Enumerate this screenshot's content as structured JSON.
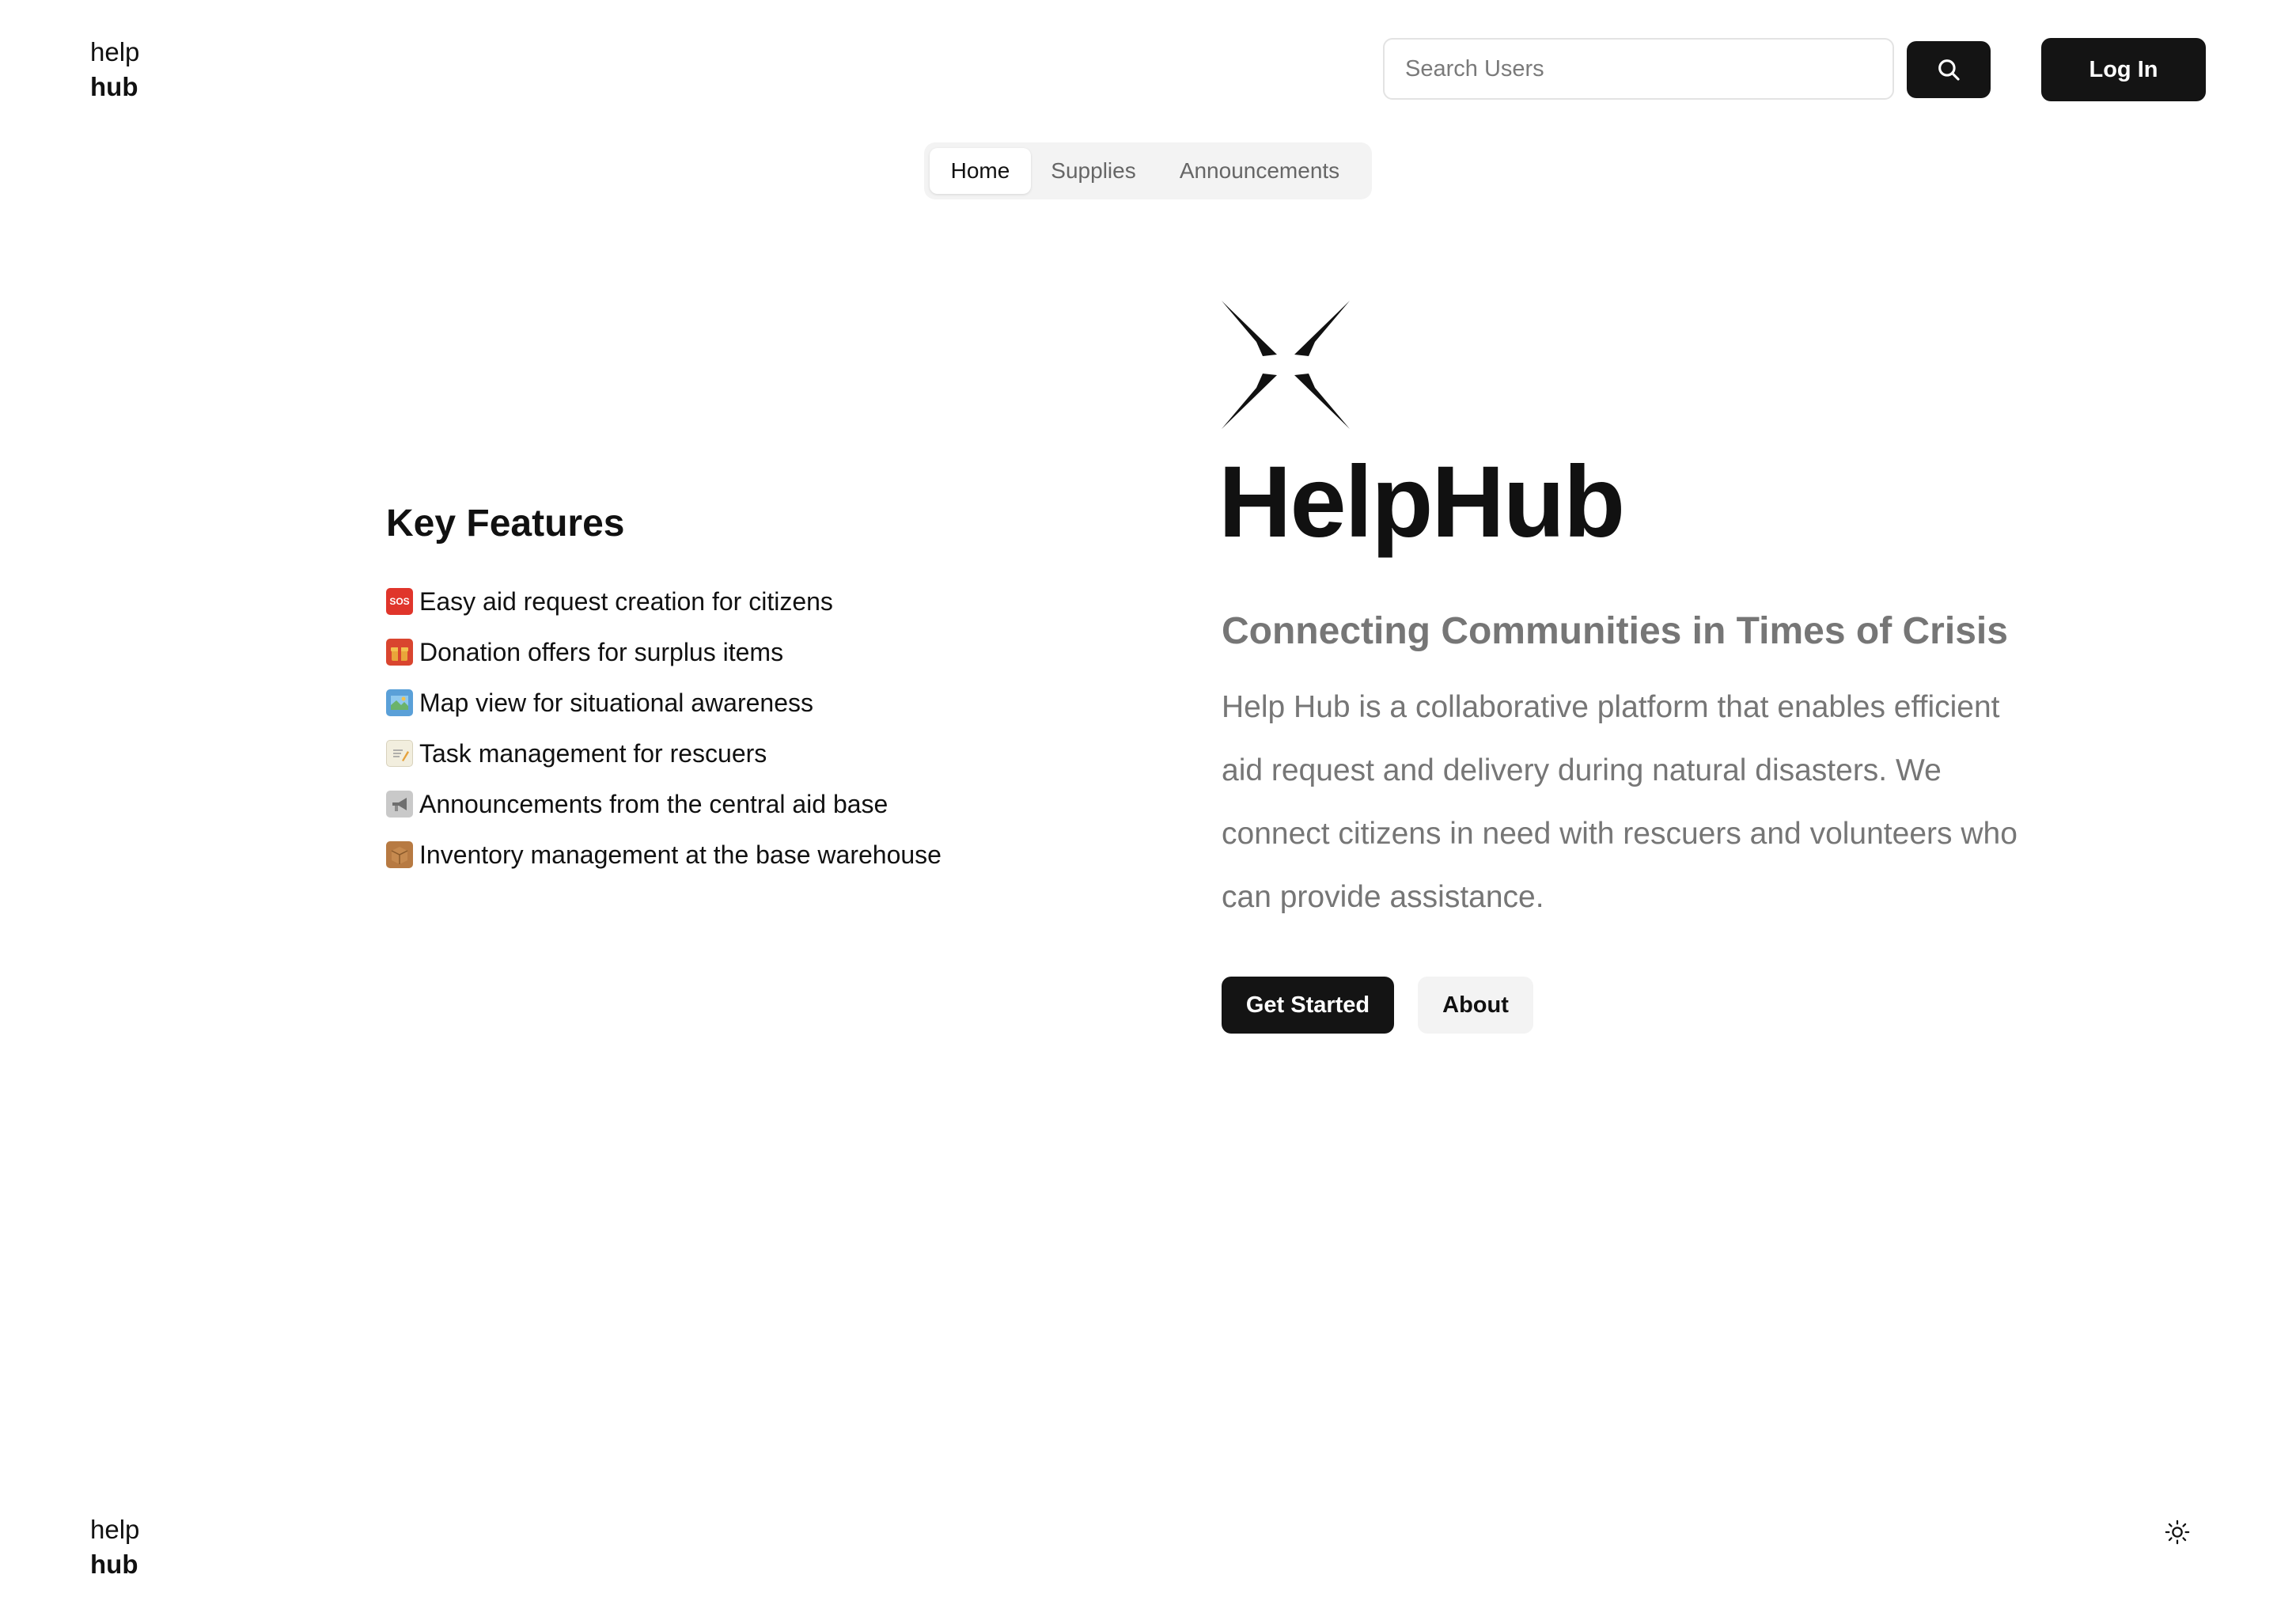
{
  "header": {
    "brand_line1": "help",
    "brand_line2": "hub",
    "search_placeholder": "Search Users",
    "search_icon": "search-icon",
    "login_label": "Log In"
  },
  "nav": {
    "tabs": [
      {
        "label": "Home",
        "active": true
      },
      {
        "label": "Supplies",
        "active": false
      },
      {
        "label": "Announcements",
        "active": false
      }
    ]
  },
  "features": {
    "title": "Key Features",
    "items": [
      {
        "icon": "sos-icon",
        "text": "Easy aid request creation for citizens"
      },
      {
        "icon": "gift-icon",
        "text": "Donation offers for surplus items"
      },
      {
        "icon": "map-icon",
        "text": "Map view for situational awareness"
      },
      {
        "icon": "memo-icon",
        "text": "Task management for rescuers"
      },
      {
        "icon": "megaphone-icon",
        "text": "Announcements from the central aid base"
      },
      {
        "icon": "package-icon",
        "text": "Inventory management at the base warehouse"
      }
    ]
  },
  "hero": {
    "logo_icon": "helphub-logo-icon",
    "title": "HelpHub",
    "subtitle": "Connecting Communities in Times of Crisis",
    "description": "Help Hub is a collaborative platform that enables efficient aid request and delivery during natural disasters. We connect citizens in need with rescuers and volunteers who can provide assistance.",
    "primary_button": "Get Started",
    "secondary_button": "About"
  },
  "footer": {
    "brand_line1": "help",
    "brand_line2": "hub",
    "theme_icon": "sun-icon"
  },
  "colors": {
    "primary": "#141414",
    "muted_text": "#767676",
    "tab_background": "#f3f3f3",
    "background": "#ffffff"
  }
}
